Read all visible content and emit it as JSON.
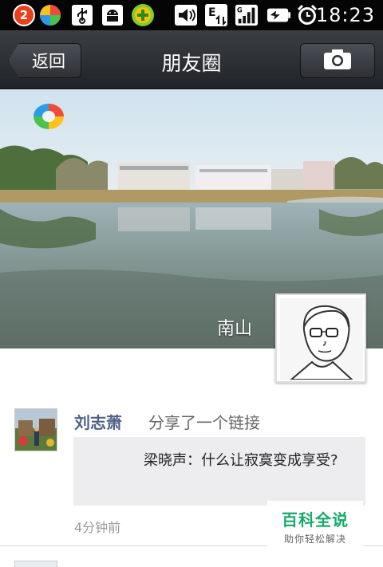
{
  "status_bar": {
    "notification_count": "2",
    "time": "18:23",
    "icons": [
      "app-store-icon",
      "usb-icon",
      "android-debug-icon",
      "security-plus-icon",
      "volume-icon",
      "data-e-icon",
      "signal-icon",
      "battery-charging-icon",
      "alarm-icon"
    ]
  },
  "header": {
    "back_label": "返回",
    "title": "朋友圈",
    "camera_icon": "camera-icon"
  },
  "cover": {
    "owner_name": "南山"
  },
  "feed": [
    {
      "user_name": "刘志萧",
      "action": "分享了一个链接",
      "link_title": "梁晓声：什么让寂寞变成享受?",
      "time": "4分钟前"
    }
  ],
  "watermark": {
    "main": "百科全说",
    "sub": "助你轻松解决"
  },
  "colors": {
    "title_bar": "#2b2e33",
    "name_blue": "#506288",
    "link_bg": "#ededf0",
    "watermark_green": "#19a96b"
  }
}
